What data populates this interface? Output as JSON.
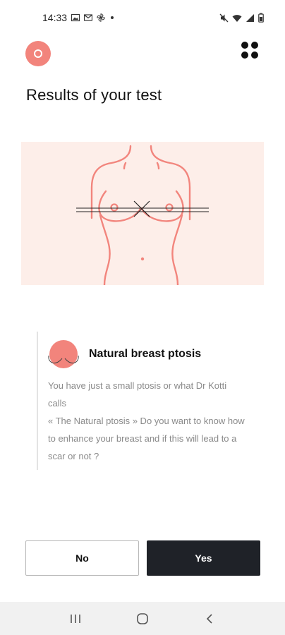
{
  "status_bar": {
    "time": "14:33",
    "left_icons": [
      "gallery-icon",
      "mail-icon",
      "pinwheel-icon",
      "dot-icon"
    ],
    "right_icons": [
      "mute-icon",
      "wifi-icon",
      "signal-icon",
      "battery-icon"
    ]
  },
  "header": {
    "logo_icon": "logo-icon",
    "menu_icon": "grid-menu-icon"
  },
  "page": {
    "title": "Results of your test"
  },
  "illustration": {
    "icon": "torso-illustration-icon",
    "background": "#fdeee9",
    "line_color": "#f2857d"
  },
  "result": {
    "icon": "breast-ptosis-icon",
    "heading": "Natural breast ptosis",
    "body_lines": [
      " You have just a small ptosis or what Dr Kotti",
      "calls",
      "« The Natural ptosis » Do you want to know how",
      "to enhance your breast and if this will lead to a",
      "scar or not ?"
    ]
  },
  "actions": {
    "no_label": "No",
    "yes_label": "Yes"
  },
  "nav_bar": {
    "recents_icon": "recents-icon",
    "home_icon": "home-icon",
    "back_icon": "back-icon"
  },
  "colors": {
    "accent": "#f2847c",
    "dark_button": "#1f2228"
  }
}
